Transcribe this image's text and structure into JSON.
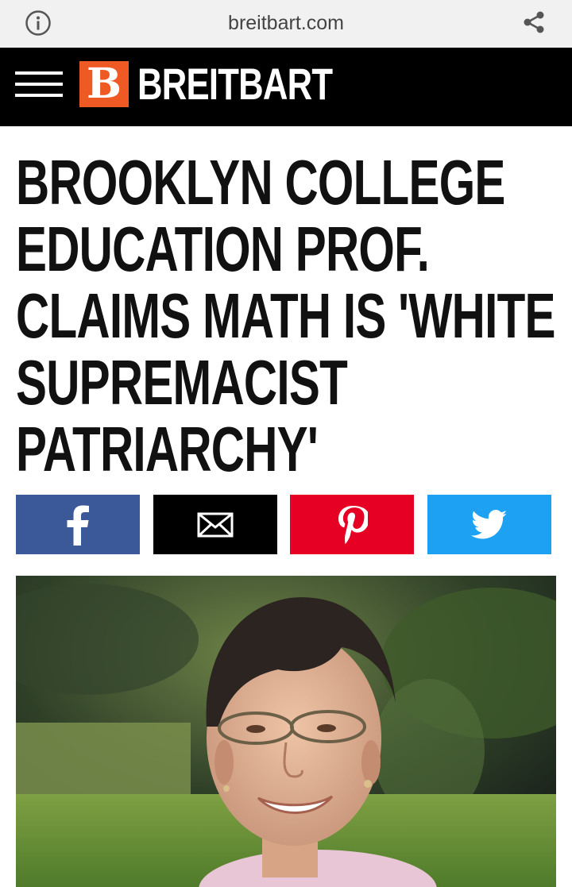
{
  "browser": {
    "url": "breitbart.com",
    "icons": [
      "info-icon",
      "share-icon"
    ]
  },
  "header": {
    "logo_letter": "B",
    "brand": "BREITBART",
    "icons": [
      "menu-icon"
    ]
  },
  "article": {
    "headline_lines": [
      "BROOKLYN COLLEGE",
      "EDUCATION PROF.",
      "CLAIMS MATH IS 'WHITE",
      "SUPREMACIST",
      "PATRIARCHY'"
    ]
  },
  "share_buttons": [
    {
      "icon": "facebook-icon",
      "color": "#3b5998"
    },
    {
      "icon": "email-icon",
      "color": "#000000"
    },
    {
      "icon": "pinterest-icon",
      "color": "#e60023"
    },
    {
      "icon": "twitter-icon",
      "color": "#1da1f2"
    }
  ],
  "colors": {
    "brand_orange": "#ef5a24",
    "header_bg": "#000000",
    "urlbar_bg": "#f1f1f1"
  }
}
